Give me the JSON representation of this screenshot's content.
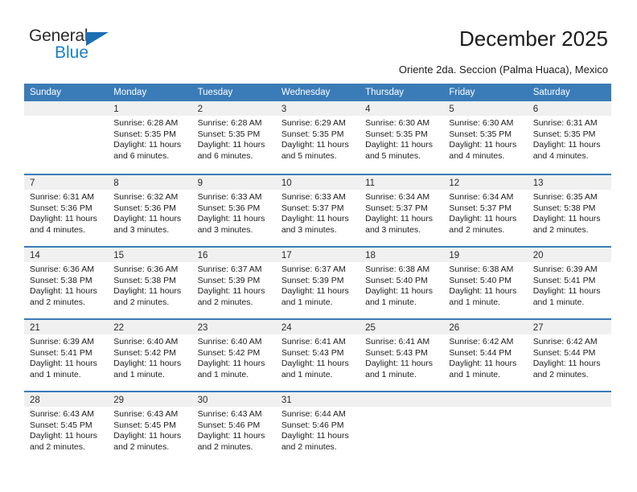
{
  "brand": {
    "name_part1": "General",
    "name_part2": "Blue",
    "triangle_color": "#1a6fb5",
    "blue_color": "#1a7fc8"
  },
  "header": {
    "title": "December 2025",
    "subtitle": "Oriente 2da. Seccion (Palma Huaca), Mexico"
  },
  "calendar": {
    "header_bg": "#3a7cb8",
    "weekdays": [
      "Sunday",
      "Monday",
      "Tuesday",
      "Wednesday",
      "Thursday",
      "Friday",
      "Saturday"
    ],
    "weeks": [
      [
        {
          "day": "",
          "lines": []
        },
        {
          "day": "1",
          "lines": [
            "Sunrise: 6:28 AM",
            "Sunset: 5:35 PM",
            "Daylight: 11 hours",
            "and 6 minutes."
          ]
        },
        {
          "day": "2",
          "lines": [
            "Sunrise: 6:28 AM",
            "Sunset: 5:35 PM",
            "Daylight: 11 hours",
            "and 6 minutes."
          ]
        },
        {
          "day": "3",
          "lines": [
            "Sunrise: 6:29 AM",
            "Sunset: 5:35 PM",
            "Daylight: 11 hours",
            "and 5 minutes."
          ]
        },
        {
          "day": "4",
          "lines": [
            "Sunrise: 6:30 AM",
            "Sunset: 5:35 PM",
            "Daylight: 11 hours",
            "and 5 minutes."
          ]
        },
        {
          "day": "5",
          "lines": [
            "Sunrise: 6:30 AM",
            "Sunset: 5:35 PM",
            "Daylight: 11 hours",
            "and 4 minutes."
          ]
        },
        {
          "day": "6",
          "lines": [
            "Sunrise: 6:31 AM",
            "Sunset: 5:35 PM",
            "Daylight: 11 hours",
            "and 4 minutes."
          ]
        }
      ],
      [
        {
          "day": "7",
          "lines": [
            "Sunrise: 6:31 AM",
            "Sunset: 5:36 PM",
            "Daylight: 11 hours",
            "and 4 minutes."
          ]
        },
        {
          "day": "8",
          "lines": [
            "Sunrise: 6:32 AM",
            "Sunset: 5:36 PM",
            "Daylight: 11 hours",
            "and 3 minutes."
          ]
        },
        {
          "day": "9",
          "lines": [
            "Sunrise: 6:33 AM",
            "Sunset: 5:36 PM",
            "Daylight: 11 hours",
            "and 3 minutes."
          ]
        },
        {
          "day": "10",
          "lines": [
            "Sunrise: 6:33 AM",
            "Sunset: 5:37 PM",
            "Daylight: 11 hours",
            "and 3 minutes."
          ]
        },
        {
          "day": "11",
          "lines": [
            "Sunrise: 6:34 AM",
            "Sunset: 5:37 PM",
            "Daylight: 11 hours",
            "and 3 minutes."
          ]
        },
        {
          "day": "12",
          "lines": [
            "Sunrise: 6:34 AM",
            "Sunset: 5:37 PM",
            "Daylight: 11 hours",
            "and 2 minutes."
          ]
        },
        {
          "day": "13",
          "lines": [
            "Sunrise: 6:35 AM",
            "Sunset: 5:38 PM",
            "Daylight: 11 hours",
            "and 2 minutes."
          ]
        }
      ],
      [
        {
          "day": "14",
          "lines": [
            "Sunrise: 6:36 AM",
            "Sunset: 5:38 PM",
            "Daylight: 11 hours",
            "and 2 minutes."
          ]
        },
        {
          "day": "15",
          "lines": [
            "Sunrise: 6:36 AM",
            "Sunset: 5:38 PM",
            "Daylight: 11 hours",
            "and 2 minutes."
          ]
        },
        {
          "day": "16",
          "lines": [
            "Sunrise: 6:37 AM",
            "Sunset: 5:39 PM",
            "Daylight: 11 hours",
            "and 2 minutes."
          ]
        },
        {
          "day": "17",
          "lines": [
            "Sunrise: 6:37 AM",
            "Sunset: 5:39 PM",
            "Daylight: 11 hours",
            "and 1 minute."
          ]
        },
        {
          "day": "18",
          "lines": [
            "Sunrise: 6:38 AM",
            "Sunset: 5:40 PM",
            "Daylight: 11 hours",
            "and 1 minute."
          ]
        },
        {
          "day": "19",
          "lines": [
            "Sunrise: 6:38 AM",
            "Sunset: 5:40 PM",
            "Daylight: 11 hours",
            "and 1 minute."
          ]
        },
        {
          "day": "20",
          "lines": [
            "Sunrise: 6:39 AM",
            "Sunset: 5:41 PM",
            "Daylight: 11 hours",
            "and 1 minute."
          ]
        }
      ],
      [
        {
          "day": "21",
          "lines": [
            "Sunrise: 6:39 AM",
            "Sunset: 5:41 PM",
            "Daylight: 11 hours",
            "and 1 minute."
          ]
        },
        {
          "day": "22",
          "lines": [
            "Sunrise: 6:40 AM",
            "Sunset: 5:42 PM",
            "Daylight: 11 hours",
            "and 1 minute."
          ]
        },
        {
          "day": "23",
          "lines": [
            "Sunrise: 6:40 AM",
            "Sunset: 5:42 PM",
            "Daylight: 11 hours",
            "and 1 minute."
          ]
        },
        {
          "day": "24",
          "lines": [
            "Sunrise: 6:41 AM",
            "Sunset: 5:43 PM",
            "Daylight: 11 hours",
            "and 1 minute."
          ]
        },
        {
          "day": "25",
          "lines": [
            "Sunrise: 6:41 AM",
            "Sunset: 5:43 PM",
            "Daylight: 11 hours",
            "and 1 minute."
          ]
        },
        {
          "day": "26",
          "lines": [
            "Sunrise: 6:42 AM",
            "Sunset: 5:44 PM",
            "Daylight: 11 hours",
            "and 1 minute."
          ]
        },
        {
          "day": "27",
          "lines": [
            "Sunrise: 6:42 AM",
            "Sunset: 5:44 PM",
            "Daylight: 11 hours",
            "and 2 minutes."
          ]
        }
      ],
      [
        {
          "day": "28",
          "lines": [
            "Sunrise: 6:43 AM",
            "Sunset: 5:45 PM",
            "Daylight: 11 hours",
            "and 2 minutes."
          ]
        },
        {
          "day": "29",
          "lines": [
            "Sunrise: 6:43 AM",
            "Sunset: 5:45 PM",
            "Daylight: 11 hours",
            "and 2 minutes."
          ]
        },
        {
          "day": "30",
          "lines": [
            "Sunrise: 6:43 AM",
            "Sunset: 5:46 PM",
            "Daylight: 11 hours",
            "and 2 minutes."
          ]
        },
        {
          "day": "31",
          "lines": [
            "Sunrise: 6:44 AM",
            "Sunset: 5:46 PM",
            "Daylight: 11 hours",
            "and 2 minutes."
          ]
        },
        {
          "day": "",
          "lines": []
        },
        {
          "day": "",
          "lines": []
        },
        {
          "day": "",
          "lines": []
        }
      ]
    ]
  }
}
